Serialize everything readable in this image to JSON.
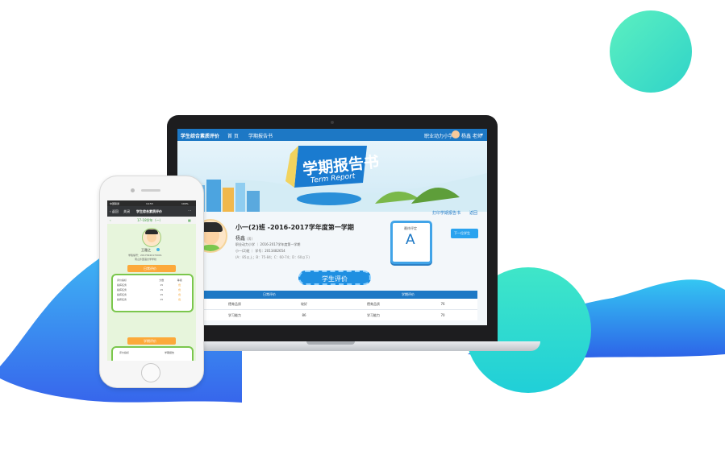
{
  "colors": {
    "primary": "#1d78c5",
    "accent": "#fcae16",
    "green": "#7bc74d",
    "cyan": "#39e0c5",
    "blue": "#2b6fe3"
  },
  "laptop": {
    "topbar": {
      "app_title": "学生综合素质评价",
      "nav_home": "首 页",
      "nav_report": "学期报告书",
      "school": "职业动力小学",
      "user": "杨鑫 老师"
    },
    "banner": {
      "title_cn": "学期报告书",
      "title_en": "Term Report"
    },
    "actions": {
      "print": "打印学期报告书",
      "back": "返回",
      "next_student": "下一位学生"
    },
    "student": {
      "class_title": "小一(2)班 -2016-2017学年度第一学期",
      "name": "杨鑫",
      "gender": "(男)",
      "school_line": "职业动力小学 ｜ 2016-2017学年度第一学期",
      "id_line": "小一(2)班 ｜ 学号：2013482654",
      "grade_scale": "(A：85以上；B：75-84；C：60-74；D：60以下)"
    },
    "final_grade": {
      "label": "最终评定",
      "value": "A"
    },
    "section_title": "学生评价",
    "table": {
      "headers": [
        "日常评价",
        "学期评价"
      ],
      "rows": [
        [
          "德育品质",
          "较好",
          "德育品质",
          "76"
        ],
        [
          "学习能力",
          "86",
          "学习能力",
          "70"
        ]
      ]
    }
  },
  "phone": {
    "status": {
      "carrier": "中国联通",
      "time": "14:53",
      "battery": "100%"
    },
    "nav": {
      "back": "返回",
      "close": "关闭",
      "title": "学生综合素质评价"
    },
    "term": "17-18学年（一）",
    "student": {
      "name": "王雅之",
      "id_line": "学籍编号：20170920170001",
      "class_line": "南山外国语文学学校"
    },
    "sec1_title": "日常评价",
    "sec1_headers": [
      "评价指标",
      "分数",
      "等级"
    ],
    "sec1_rows": [
      [
        "指挥任务",
        "15",
        "优"
      ],
      [
        "指挥任务",
        "15",
        "优"
      ],
      [
        "指挥任务",
        "15",
        "优"
      ],
      [
        "指挥任务",
        "15",
        "优"
      ]
    ],
    "sec2_title": "学期评价",
    "sec2_headers": [
      "评价指标",
      "学期报告"
    ]
  }
}
